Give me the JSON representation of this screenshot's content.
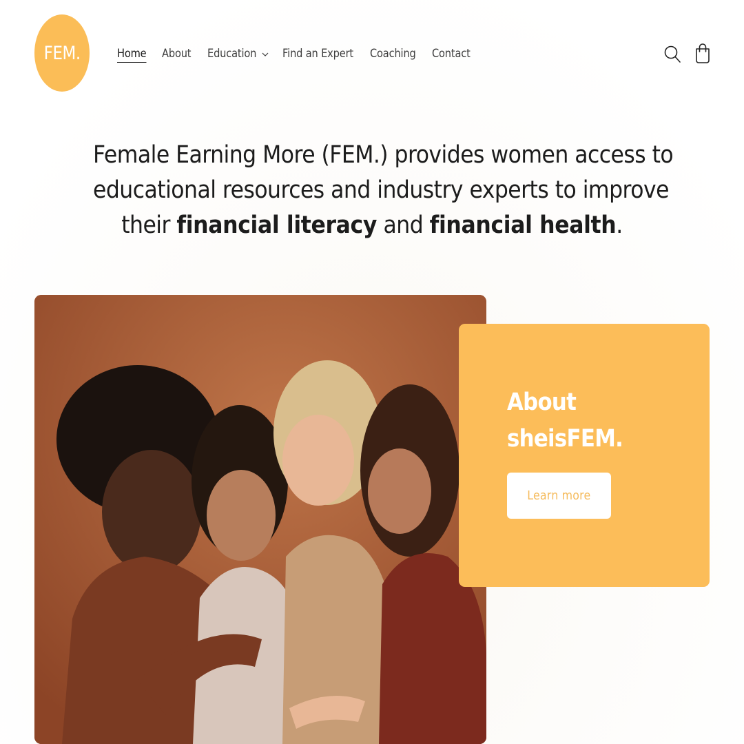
{
  "header": {
    "logo_text": "FEM.",
    "nav": [
      {
        "label": "Home",
        "active": true
      },
      {
        "label": "About"
      },
      {
        "label": "Education",
        "has_dropdown": true
      },
      {
        "label": "Find an Expert"
      },
      {
        "label": "Coaching"
      },
      {
        "label": "Contact"
      }
    ],
    "icons": [
      "search-icon",
      "cart-icon"
    ]
  },
  "hero": {
    "line1": "Female Earning More (FEM.) provides women access to",
    "line2": "educational resources and industry experts to improve",
    "line3_prefix": "their ",
    "line3_bold1": "financial literacy",
    "line3_mid": " and ",
    "line3_bold2": "financial health",
    "line3_suffix": "."
  },
  "about_card": {
    "title_line1": "About",
    "title_line2": "sheisFEM.",
    "button_label": "Learn more"
  },
  "colors": {
    "brand_yellow": "#fcbd59",
    "text_dark": "#1c1c1c",
    "button_text": "#f5bb5c"
  }
}
